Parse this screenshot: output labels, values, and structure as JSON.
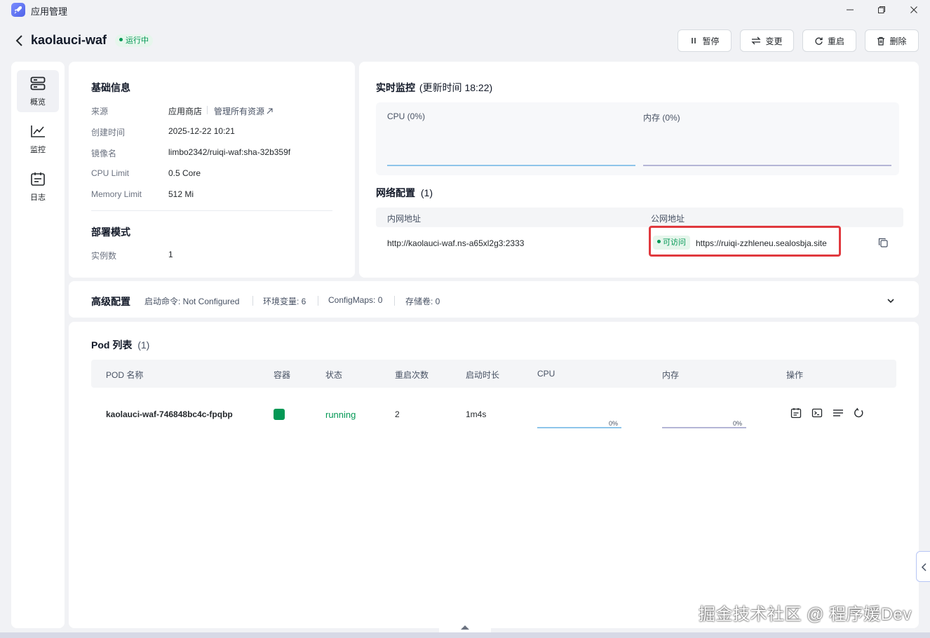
{
  "window": {
    "title": "应用管理"
  },
  "header": {
    "app_name": "kaolauci-waf",
    "status": "运行中",
    "buttons": {
      "pause": "暂停",
      "update": "变更",
      "restart": "重启",
      "delete": "删除"
    }
  },
  "nav": {
    "items": [
      {
        "label": "概览"
      },
      {
        "label": "监控"
      },
      {
        "label": "日志"
      }
    ]
  },
  "basic_info": {
    "title": "基础信息",
    "source_label": "来源",
    "source_value": "应用商店",
    "manage_link": "管理所有资源",
    "created_label": "创建时间",
    "created_value": "2025-12-22 10:21",
    "image_label": "镜像名",
    "image_value": "limbo2342/ruiqi-waf:sha-32b359f",
    "cpu_label": "CPU Limit",
    "cpu_value": "0.5 Core",
    "memory_label": "Memory Limit",
    "memory_value": "512 Mi",
    "deploy_title": "部署模式",
    "replicas_label": "实例数",
    "replicas_value": "1"
  },
  "monitor": {
    "title": "实时监控",
    "updated": "(更新时间  18:22)",
    "cpu_label": "CPU  (0%)",
    "memory_label": "内存  (0%)",
    "cpu_line_color": "#8ec5ea",
    "memory_line_color": "#b4b5d6"
  },
  "network": {
    "title": "网络配置",
    "count": "(1)",
    "col_private": "内网地址",
    "col_public": "公网地址",
    "private_address": "http://kaolauci-waf.ns-a65xl2g3:2333",
    "access_badge": "可访问",
    "public_address": "https://ruiqi-zzhleneu.sealosbja.site"
  },
  "advanced": {
    "title": "高级配置",
    "command": "启动命令: Not Configured",
    "env": "环境变量: 6",
    "configmaps": "ConfigMaps: 0",
    "volumes": "存储卷: 0"
  },
  "pods": {
    "title": "Pod 列表",
    "count": "(1)",
    "columns": [
      "POD 名称",
      "容器",
      "状态",
      "重启次数",
      "启动时长",
      "CPU",
      "内存",
      "操作"
    ],
    "rows": [
      {
        "name": "kaolauci-waf-746848bc4c-fpqbp",
        "container_color": "#039855",
        "status": "running",
        "restarts": "2",
        "uptime": "1m4s",
        "cpu": "0%",
        "memory": "0%"
      }
    ]
  },
  "watermark": "掘金技术社区 @ 程序媛Dev",
  "colors": {
    "accent": "#039855",
    "highlight": "#e0393e",
    "bg": "#f1f2f5"
  }
}
